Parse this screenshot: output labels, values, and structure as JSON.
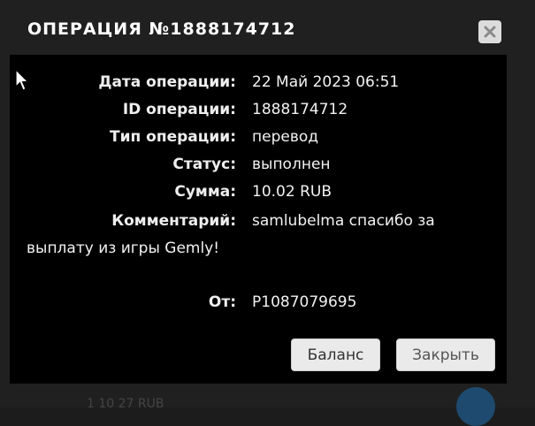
{
  "modal": {
    "title": "ОПЕРАЦИЯ №1888174712",
    "close_icon": "close-icon"
  },
  "details": {
    "date_label": "Дата операции:",
    "date_value": "22 Май 2023 06:51",
    "id_label": "ID операции:",
    "id_value": "1888174712",
    "type_label": "Тип операции:",
    "type_value": "перевод",
    "status_label": "Статус:",
    "status_value": "выполнен",
    "amount_label": "Сумма:",
    "amount_value": "10.02 RUB",
    "comment_label": "Комментарий:",
    "comment_value": "samlubelma спасибо за выплату из игры Gemly!",
    "from_label": "От:",
    "from_value": "P1087079695"
  },
  "buttons": {
    "balance_label": "Баланс",
    "close_label": "Закрыть"
  },
  "background": {
    "peek_text": "1 10 27 RUB"
  },
  "colors": {
    "body_bg": "#000000",
    "header_bg": "#202020",
    "button_bg": "#eaeaea"
  }
}
